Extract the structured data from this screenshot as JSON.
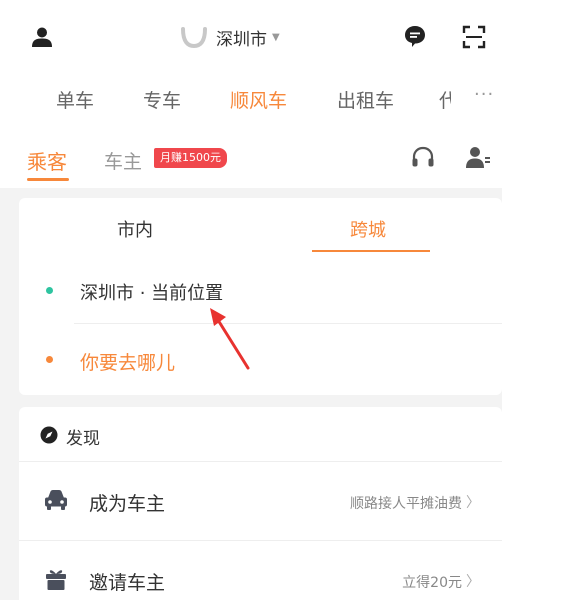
{
  "header": {
    "city": "深圳市",
    "user_icon": "user-icon",
    "message_icon": "message-icon",
    "scan_icon": "scan-icon"
  },
  "service_tabs": [
    {
      "label": "单车",
      "active": false
    },
    {
      "label": "专车",
      "active": false
    },
    {
      "label": "顺风车",
      "active": true
    },
    {
      "label": "出租车",
      "active": false
    },
    {
      "label": "代",
      "active": false
    }
  ],
  "service_more": "···",
  "roles": {
    "passenger": "乘客",
    "driver": "车主",
    "driver_badge": "月赚1500元",
    "headset_icon": "headset-icon",
    "profile_icon": "profile-icon"
  },
  "route": {
    "tab_city": "市内",
    "tab_intercity": "跨城",
    "origin": "深圳市 · 当前位置",
    "destination": "你要去哪儿"
  },
  "discover": {
    "title": "发现",
    "items": [
      {
        "label": "成为车主",
        "note": "顺路接人平摊油费",
        "icon": "car-icon"
      },
      {
        "label": "邀请车主",
        "note": "立得20元",
        "icon": "gift-icon"
      }
    ]
  },
  "colors": {
    "accent": "#f7883b",
    "badge": "#f0474c",
    "origin_dot": "#2ec4a0",
    "annotation_arrow": "#e8322f"
  }
}
